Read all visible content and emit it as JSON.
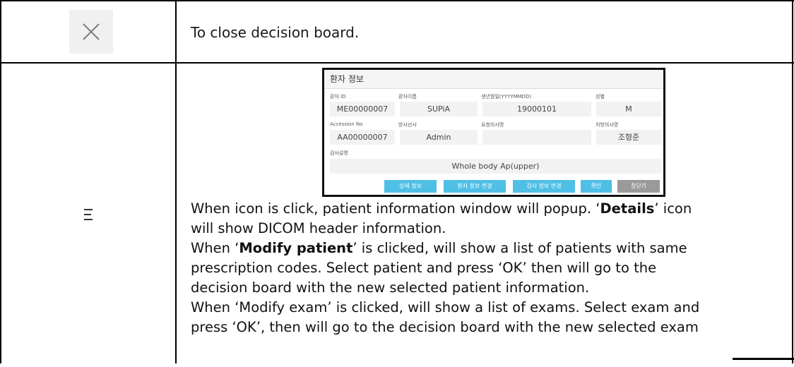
{
  "rows": [
    {
      "icon": "close-icon",
      "description": "To close decision board."
    },
    {
      "icon": "menu-icon",
      "popup": {
        "title": "환자 정보",
        "fields": [
          {
            "label": "환자 ID",
            "value": "ME00000007"
          },
          {
            "label": "환자이름",
            "value": "SUPiA"
          },
          {
            "label": "생년월일(YYYYMMDD)",
            "value": "19000101"
          },
          {
            "label": "성별",
            "value": "M"
          },
          {
            "label": "Accession No",
            "value": "AA00000007"
          },
          {
            "label": "방사선사",
            "value": "Admin"
          },
          {
            "label": "요청의사명",
            "value": ""
          },
          {
            "label": "처방의사명",
            "value": "조형준"
          },
          {
            "label": "검사설명",
            "value": "Whole body Ap(upper)"
          }
        ],
        "buttons": [
          {
            "label": "상세 정보",
            "color": "#4fbfe6"
          },
          {
            "label": "환자 정보 변경",
            "color": "#4fbfe6"
          },
          {
            "label": "검사 정보 변경",
            "color": "#4fbfe6"
          },
          {
            "label": "확인",
            "color": "#4fbfe6"
          },
          {
            "label": "창닫기",
            "color": "#9a9a9a"
          }
        ]
      },
      "description": {
        "l1_a": "When icon is click, patient information window will popup. ‘",
        "l1_b": "Details",
        "l1_c": "’ icon",
        "l2": "will show DICOM header information.",
        "l3_a": "When ‘",
        "l3_b": "Modify patient",
        "l3_c": "’ is clicked, will show a list of patients with same",
        "l4": "prescription codes. Select patient and press ‘OK’ then will go to the",
        "l5": "decision board with the new selected patient information.",
        "l6": "When ‘Modify exam’ is clicked, will show a list of exams. Select exam and",
        "l7": "press ‘OK’, then will go to the decision board with the new selected exam"
      }
    }
  ]
}
